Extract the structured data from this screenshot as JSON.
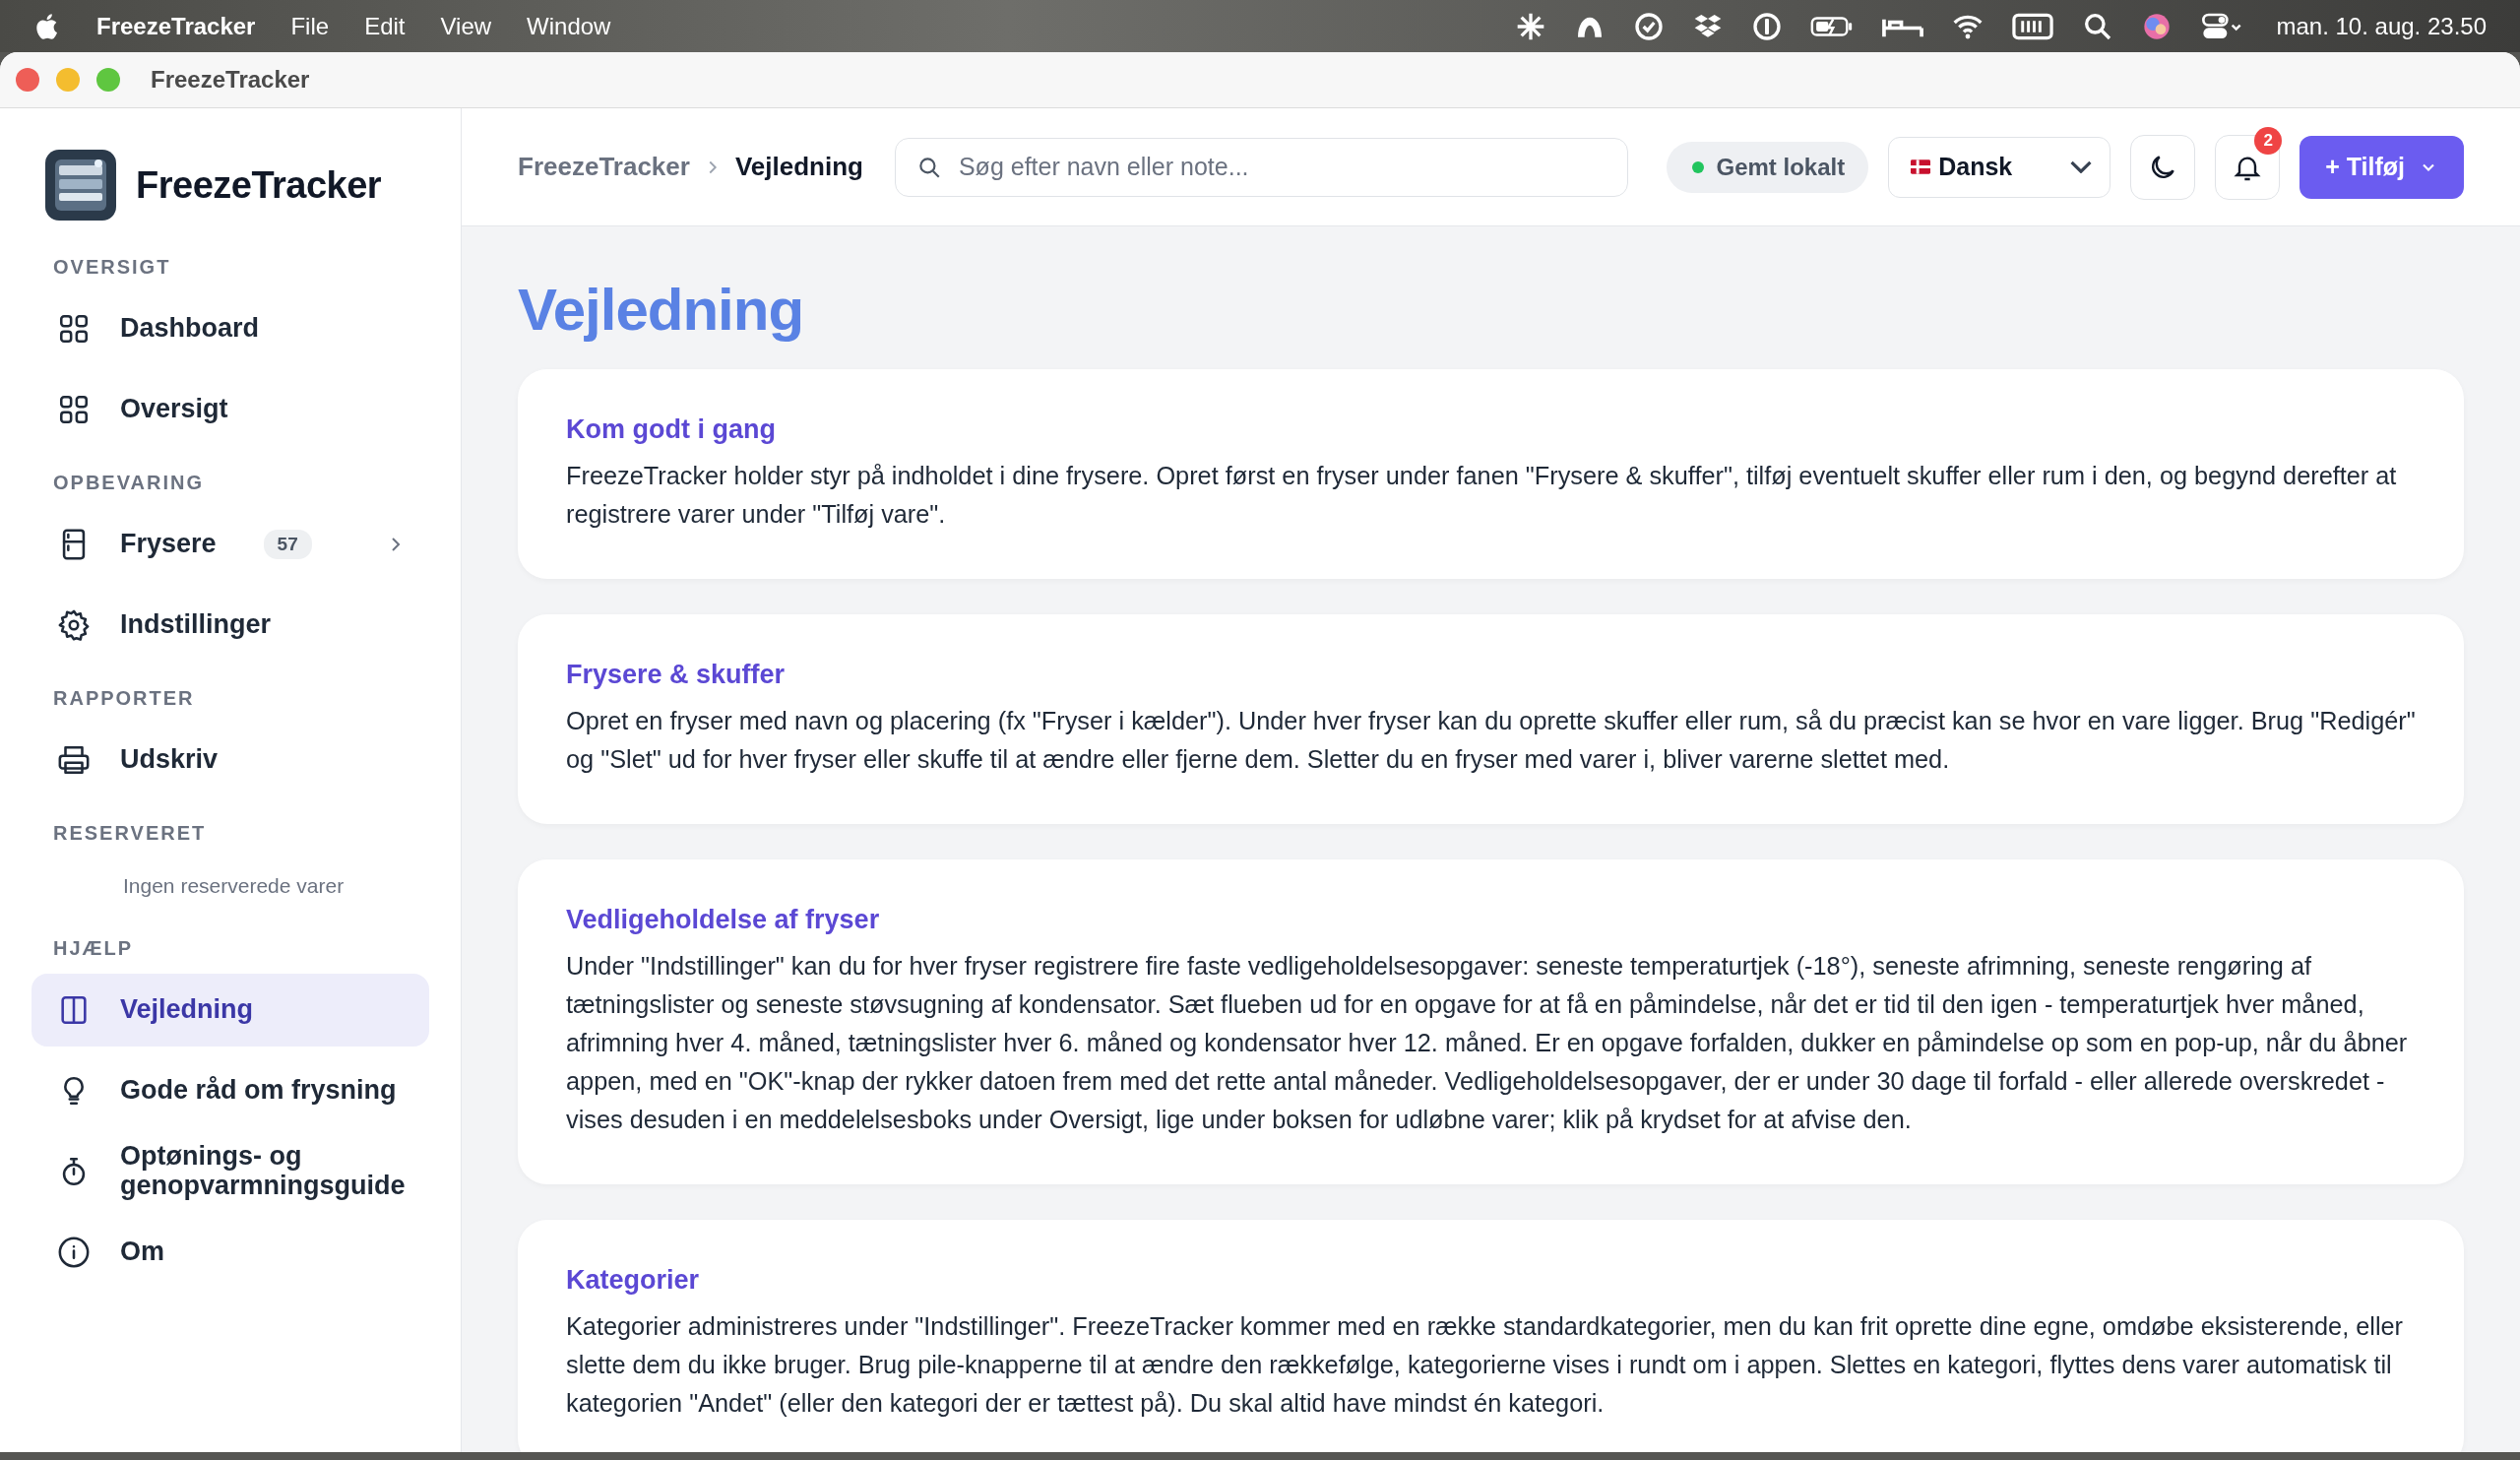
{
  "menubar": {
    "app": "FreezeTracker",
    "menus": [
      "File",
      "Edit",
      "View",
      "Window"
    ],
    "clock": "man. 10. aug. 23.50"
  },
  "window": {
    "title": "FreezeTracker"
  },
  "sidebar": {
    "brand": "FreezeTracker",
    "sections": [
      {
        "label": "OVERSIGT",
        "items": [
          {
            "label": "Dashboard",
            "kind": "grid",
            "selected": false
          },
          {
            "label": "Oversigt",
            "kind": "grid",
            "selected": false
          }
        ]
      },
      {
        "label": "OPBEVARING",
        "items": [
          {
            "label": "Frysere",
            "kind": "fridge",
            "badge": "57",
            "expanded": false,
            "selected": false
          },
          {
            "label": "Indstillinger",
            "kind": "gear",
            "selected": false
          }
        ]
      },
      {
        "label": "RAPPORTER",
        "items": [
          {
            "label": "Udskriv",
            "kind": "printer",
            "selected": false
          }
        ]
      },
      {
        "label": "RESERVERET",
        "empty_text": "Ingen reserverede varer"
      },
      {
        "label": "HJÆLP",
        "items": [
          {
            "label": "Vejledning",
            "kind": "book",
            "selected": true
          },
          {
            "label": "Gode råd om frysning",
            "kind": "bulb",
            "selected": false
          },
          {
            "label": "Optønings- og genopvarmningsguide",
            "kind": "timer",
            "selected": false
          },
          {
            "label": "Om",
            "kind": "info",
            "selected": false
          }
        ]
      }
    ]
  },
  "header": {
    "breadcrumb": [
      "FreezeTracker",
      "Vejledning"
    ],
    "search": {
      "placeholder": "Søg efter navn eller note..."
    },
    "status": "Gemt lokalt",
    "language": "Dansk",
    "notifications": "2",
    "add_button": "+ Tilføj"
  },
  "page": {
    "title": "Vejledning",
    "cards": [
      {
        "title": "Kom godt i gang",
        "text": "FreezeTracker holder styr på indholdet i dine frysere. Opret først en fryser under fanen \"Frysere & skuffer\", tilføj eventuelt skuffer eller rum i den, og begynd derefter at registrere varer under \"Tilføj vare\"."
      },
      {
        "title": "Frysere & skuffer",
        "text": "Opret en fryser med navn og placering (fx \"Fryser i kælder\"). Under hver fryser kan du oprette skuffer eller rum, så du præcist kan se hvor en vare ligger. Brug \"Redigér\" og \"Slet\" ud for hver fryser eller skuffe til at ændre eller fjerne dem. Sletter du en fryser med varer i, bliver varerne slettet med."
      },
      {
        "title": "Vedligeholdelse af fryser",
        "text": "Under \"Indstillinger\" kan du for hver fryser registrere fire faste vedligeholdelsesopgaver: seneste temperaturtjek (-18°), seneste afrimning, seneste rengøring af tætningslister og seneste støvsugning af kondensator. Sæt flueben ud for en opgave for at få en påmindelse, når det er tid til den igen - temperaturtjek hver måned, afrimning hver 4. måned, tætningslister hver 6. måned og kondensator hver 12. måned. Er en opgave forfalden, dukker en påmindelse op som en pop-up, når du åbner appen, med en \"OK\"-knap der rykker datoen frem med det rette antal måneder. Vedligeholdelsesopgaver, der er under 30 dage til forfald - eller allerede overskredet - vises desuden i en meddelelsesboks under Oversigt, lige under boksen for udløbne varer; klik på krydset for at afvise den."
      },
      {
        "title": "Kategorier",
        "text": "Kategorier administreres under \"Indstillinger\". FreezeTracker kommer med en række standardkategorier, men du kan frit oprette dine egne, omdøbe eksisterende, eller slette dem du ikke bruger. Brug pile-knapperne til at ændre den rækkefølge, kategorierne vises i rundt om i appen. Slettes en kategori, flyttes dens varer automatisk til kategorien \"Andet\" (eller den kategori der er tættest på). Du skal altid have mindst én kategori."
      }
    ]
  }
}
